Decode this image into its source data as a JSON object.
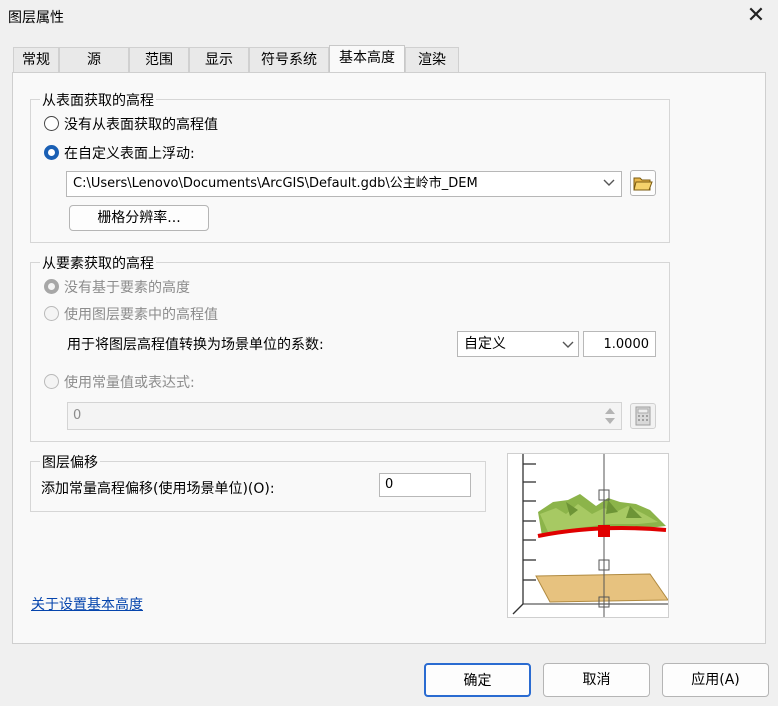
{
  "window": {
    "title": "图层属性",
    "close_glyph": "✕"
  },
  "tabs": [
    {
      "label": "常规",
      "active": false
    },
    {
      "label": "源",
      "active": false
    },
    {
      "label": "范围",
      "active": false
    },
    {
      "label": "显示",
      "active": false
    },
    {
      "label": "符号系统",
      "active": false
    },
    {
      "label": "基本高度",
      "active": true
    },
    {
      "label": "渲染",
      "active": false
    }
  ],
  "surface_group": {
    "title": "从表面获取的高程",
    "option_none": "没有从表面获取的高程值",
    "option_float": "在自定义表面上浮动:",
    "selected": "option_float",
    "surface_path": "C:\\Users\\Lenovo\\Documents\\ArcGIS\\Default.gdb\\公主岭市_DEM",
    "raster_button": "栅格分辨率..."
  },
  "feature_group": {
    "title": "从要素获取的高程",
    "option_none": "没有基于要素的高度",
    "option_layer": "使用图层要素中的高程值",
    "factor_label": "用于将图层高程值转换为场景单位的系数:",
    "factor_unit": "自定义",
    "factor_value": "1.0000",
    "option_expr": "使用常量值或表达式:",
    "expr_value": "0"
  },
  "offset_group": {
    "title": "图层偏移",
    "label": "添加常量高程偏移(使用场景单位)(O):",
    "value": "0"
  },
  "help_link": "关于设置基本高度",
  "footer": {
    "ok": "确定",
    "cancel": "取消",
    "apply": "应用(A)"
  }
}
